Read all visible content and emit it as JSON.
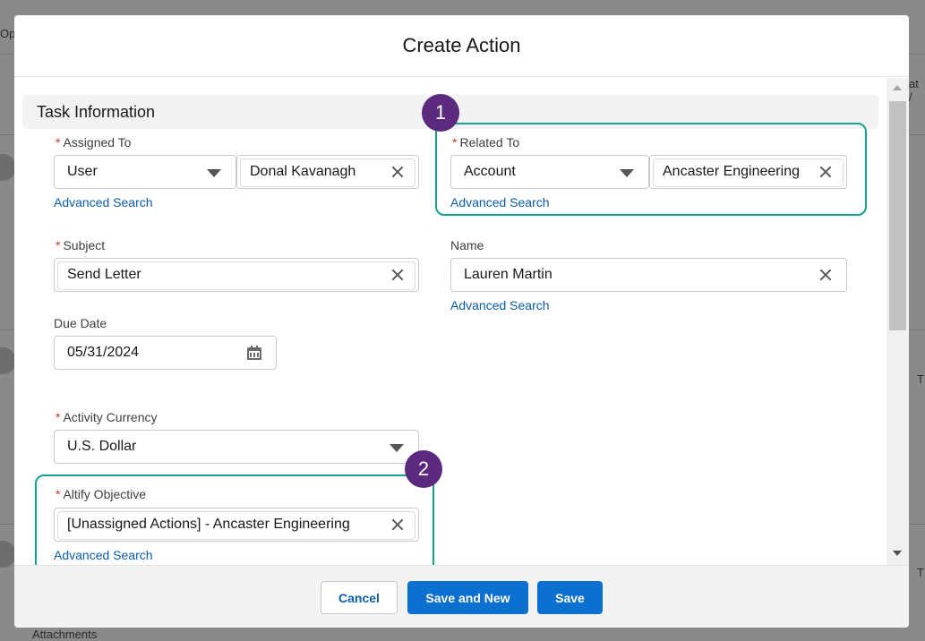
{
  "background": {
    "top_left_text": "Op",
    "top_right_text": "at /",
    "right_text_1": "T",
    "right_text_2": "T",
    "bottom_text": "Attachments"
  },
  "modal": {
    "title": "Create Action"
  },
  "section": {
    "title": "Task Information"
  },
  "required_marker": "*",
  "fields": {
    "assigned_to": {
      "label": "Assigned To",
      "type_value": "User",
      "value": "Donal Kavanagh",
      "advanced_search": "Advanced Search"
    },
    "related_to": {
      "label": "Related To",
      "type_value": "Account",
      "value": "Ancaster Engineering",
      "advanced_search": "Advanced Search"
    },
    "subject": {
      "label": "Subject",
      "value": "Send Letter"
    },
    "name": {
      "label": "Name",
      "value": "Lauren Martin",
      "advanced_search": "Advanced Search"
    },
    "due_date": {
      "label": "Due Date",
      "value": "05/31/2024"
    },
    "activity_currency": {
      "label": "Activity Currency",
      "value": "U.S. Dollar"
    },
    "altify_objective": {
      "label": "Altify Objective",
      "value": "[Unassigned Actions] - Ancaster Engineering",
      "advanced_search": "Advanced Search"
    }
  },
  "annotations": {
    "badge_1": "1",
    "badge_2": "2",
    "highlight_color": "#16a28b",
    "badge_color": "#5b2a7e"
  },
  "footer": {
    "cancel_label": "Cancel",
    "save_new_label": "Save and New",
    "save_label": "Save"
  },
  "colors": {
    "brand": "#0b70d0",
    "link": "#0b5cab",
    "required": "#c23934"
  }
}
